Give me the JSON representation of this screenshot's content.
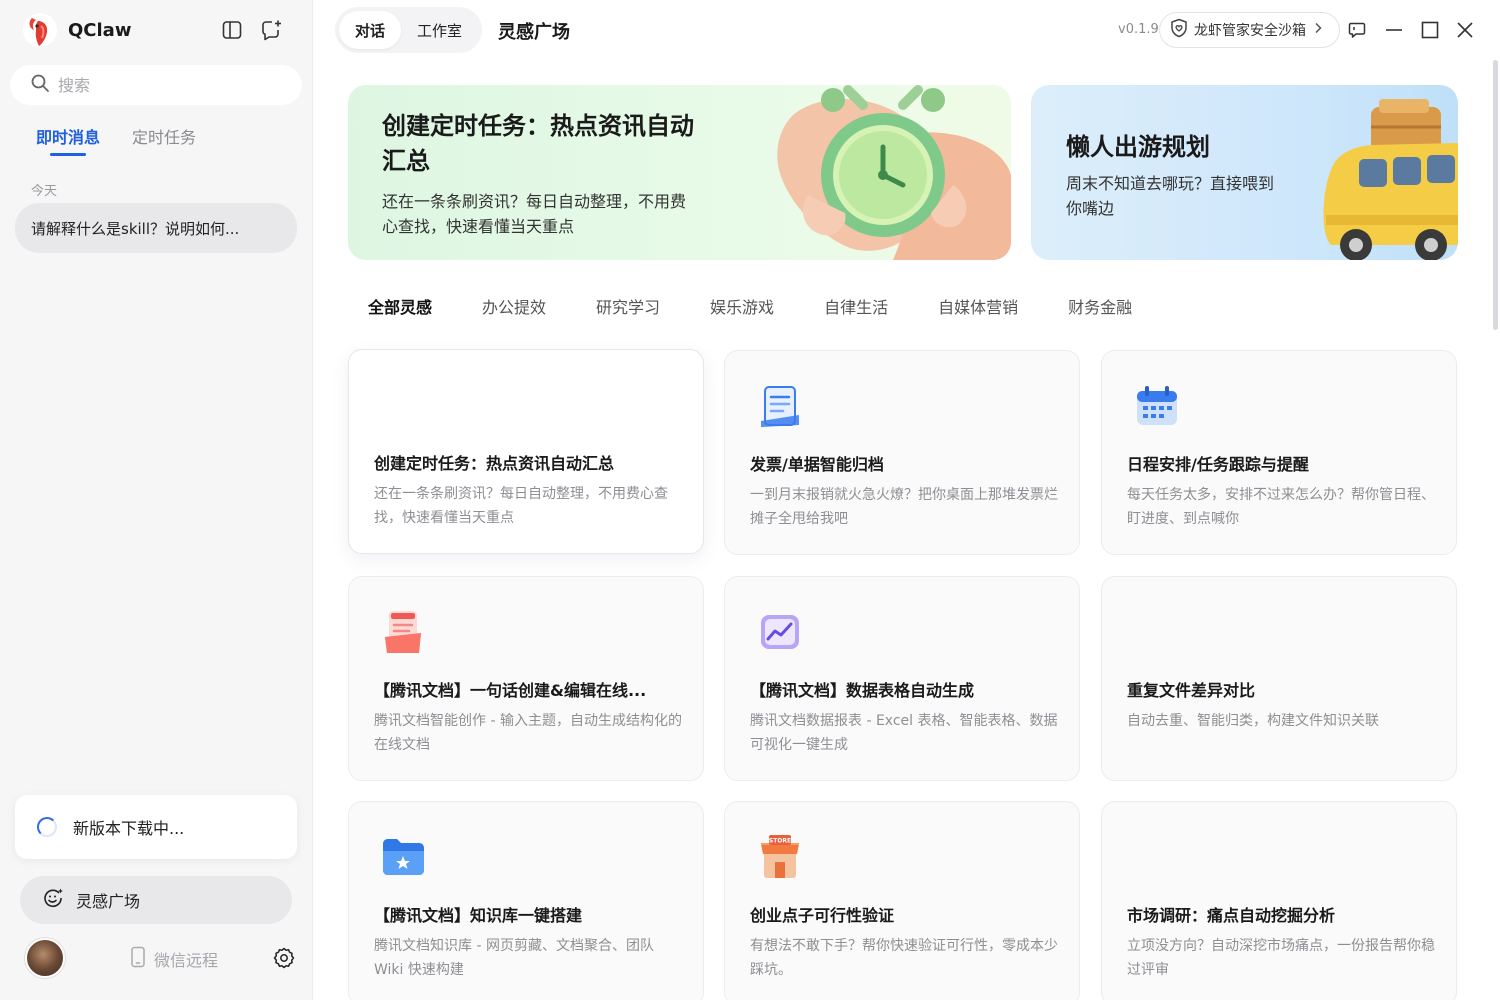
{
  "app": {
    "name": "QClaw",
    "version": "v0.1.9"
  },
  "sidebar": {
    "search_placeholder": "搜索",
    "tabs": [
      {
        "label": "即时消息",
        "active": true
      },
      {
        "label": "定时任务",
        "active": false
      }
    ],
    "date_group": "今天",
    "history": [
      {
        "title": "请解释什么是skill？说明如何..."
      }
    ],
    "download_status": "新版本下载中...",
    "inspiration_button": "灵感广场",
    "wechat_remote": "微信远程"
  },
  "topbar": {
    "tabs": [
      {
        "label": "对话",
        "active": true
      },
      {
        "label": "工作室",
        "active": false
      }
    ],
    "page_title": "灵感广场",
    "sandbox_label": "龙虾管家安全沙箱"
  },
  "banners": [
    {
      "title": "创建定时任务：热点资讯自动汇总",
      "desc": "还在一条条刷资讯？每日自动整理，不用费心查找，快速看懂当天重点",
      "illustration": "alarm-clock-in-hand"
    },
    {
      "title": "懒人出游规划",
      "desc": "周末不知道去哪玩？直接喂到你嘴边",
      "illustration": "yellow-van-with-luggage"
    }
  ],
  "categories": [
    {
      "label": "全部灵感",
      "active": true
    },
    {
      "label": "办公提效",
      "active": false
    },
    {
      "label": "研究学习",
      "active": false
    },
    {
      "label": "娱乐游戏",
      "active": false
    },
    {
      "label": "自律生活",
      "active": false
    },
    {
      "label": "自媒体营销",
      "active": false
    },
    {
      "label": "财务金融",
      "active": false
    }
  ],
  "cards": [
    {
      "title": "创建定时任务：热点资讯自动汇总",
      "desc": "还在一条条刷资讯？每日自动整理，不用费心查找，快速看懂当天重点",
      "icon": "none"
    },
    {
      "title": "发票/单据智能归档",
      "desc": "一到月末报销就火急火燎？把你桌面上那堆发票烂摊子全甩给我吧",
      "icon": "document-icon"
    },
    {
      "title": "日程安排/任务跟踪与提醒",
      "desc": "每天任务太多，安排不过来怎么办？帮你管日程、盯进度、到点喊你",
      "icon": "calendar-icon"
    },
    {
      "title": "【腾讯文档】一句话创建&编辑在线...",
      "desc": "腾讯文档智能创作 - 输入主题，自动生成结构化的在线文档",
      "icon": "tencent-doc-icon"
    },
    {
      "title": "【腾讯文档】数据表格自动生成",
      "desc": "腾讯文档数据报表 - Excel 表格、智能表格、数据可视化一键生成",
      "icon": "chart-icon"
    },
    {
      "title": "重复文件差异对比",
      "desc": "自动去重、智能归类，构建文件知识关联",
      "icon": "none"
    },
    {
      "title": "【腾讯文档】知识库一键搭建",
      "desc": "腾讯文档知识库 - 网页剪藏、文档聚合、团队 Wiki 快速构建",
      "icon": "folder-star-icon"
    },
    {
      "title": "创业点子可行性验证",
      "desc": "有想法不敢下手？帮你快速验证可行性，零成本少踩坑。",
      "icon": "store-icon"
    },
    {
      "title": "市场调研：痛点自动挖掘分析",
      "desc": "立项没方向？自动深挖市场痛点，一份报告帮你稳过评审",
      "icon": "none"
    }
  ]
}
